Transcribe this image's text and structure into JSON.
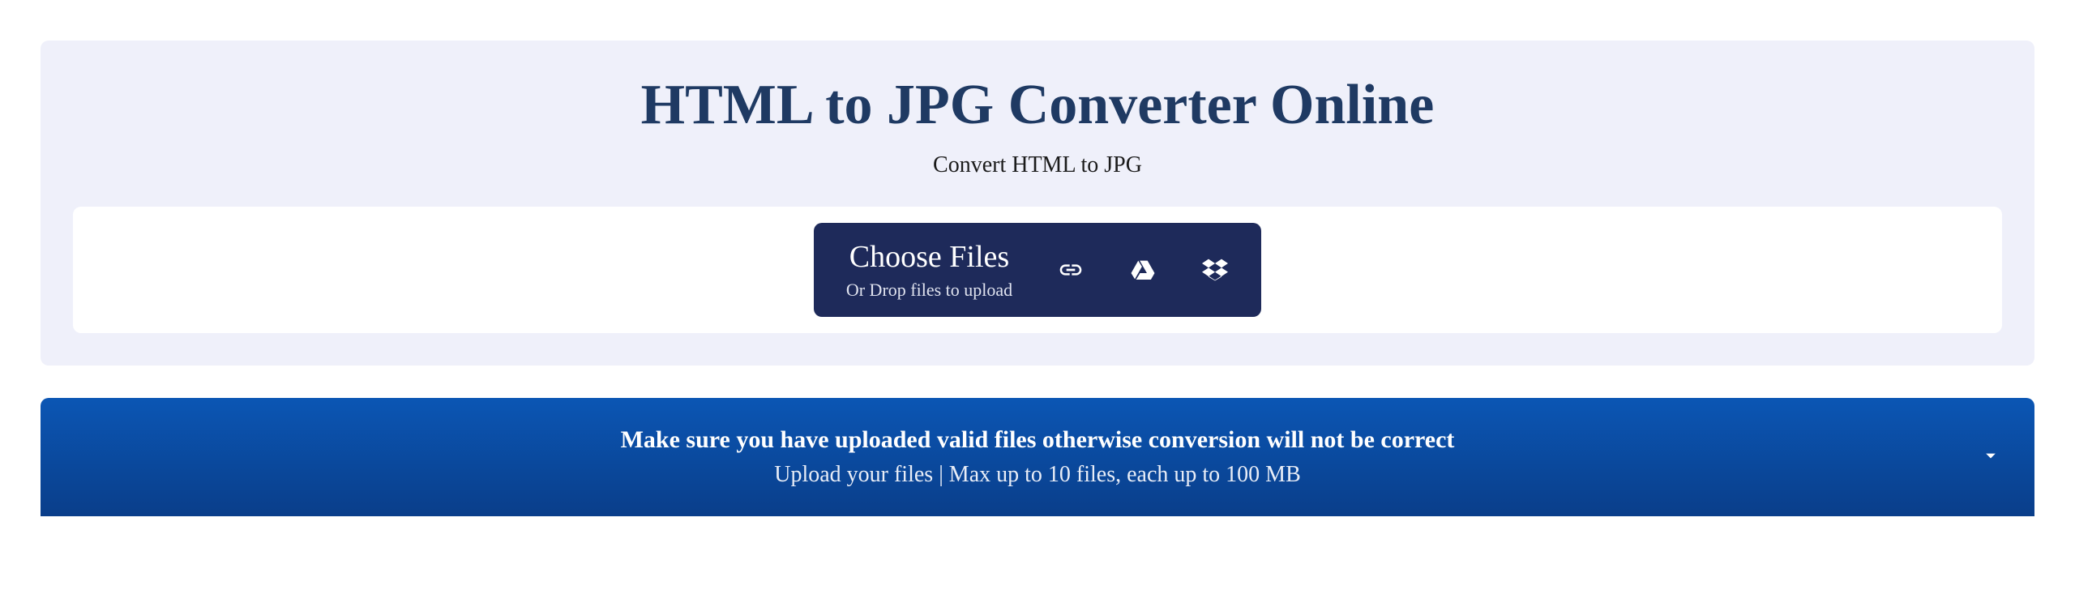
{
  "hero": {
    "title": "HTML to JPG Converter Online",
    "subtitle": "Convert HTML to JPG"
  },
  "upload": {
    "choose_label": "Choose Files",
    "drop_label": "Or Drop files to upload"
  },
  "notice": {
    "primary": "Make sure you have uploaded valid files otherwise conversion will not be correct",
    "secondary": "Upload your files | Max up to 10 files, each up to 100 MB"
  }
}
